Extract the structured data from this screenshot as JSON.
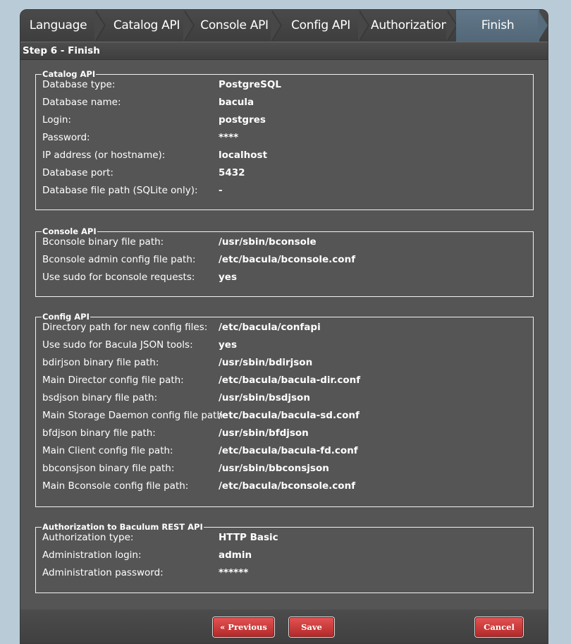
{
  "steps": [
    {
      "label": "Language"
    },
    {
      "label": "Catalog API"
    },
    {
      "label": "Console API"
    },
    {
      "label": "Config API"
    },
    {
      "label": "Authorization"
    },
    {
      "label": "Finish"
    }
  ],
  "active_step": "Finish",
  "step_title": "Step 6 - Finish",
  "sections": {
    "catalog": {
      "legend": "Catalog API",
      "rows": [
        {
          "label": "Database type:",
          "value": "PostgreSQL"
        },
        {
          "label": "Database name:",
          "value": "bacula"
        },
        {
          "label": "Login:",
          "value": "postgres"
        },
        {
          "label": "Password:",
          "value": "****"
        },
        {
          "label": "IP address (or hostname):",
          "value": "localhost"
        },
        {
          "label": "Database port:",
          "value": "5432"
        },
        {
          "label": "Database file path (SQLite only):",
          "value": "-"
        }
      ]
    },
    "console": {
      "legend": "Console API",
      "rows": [
        {
          "label": "Bconsole binary file path:",
          "value": "/usr/sbin/bconsole"
        },
        {
          "label": "Bconsole admin config file path:",
          "value": "/etc/bacula/bconsole.conf"
        },
        {
          "label": "Use sudo for bconsole requests:",
          "value": "yes"
        }
      ]
    },
    "config": {
      "legend": "Config API",
      "rows": [
        {
          "label": "Directory path for new config files:",
          "value": "/etc/bacula/confapi"
        },
        {
          "label": "Use sudo for Bacula JSON tools:",
          "value": "yes"
        },
        {
          "label": "bdirjson binary file path:",
          "value": "/usr/sbin/bdirjson"
        },
        {
          "label": "Main Director config file path:",
          "value": "/etc/bacula/bacula-dir.conf"
        },
        {
          "label": "bsdjson binary file path:",
          "value": "/usr/sbin/bsdjson"
        },
        {
          "label": "Main Storage Daemon config file path:",
          "value": "/etc/bacula/bacula-sd.conf"
        },
        {
          "label": "bfdjson binary file path:",
          "value": "/usr/sbin/bfdjson"
        },
        {
          "label": "Main Client config file path:",
          "value": "/etc/bacula/bacula-fd.conf"
        },
        {
          "label": "bbconsjson binary file path:",
          "value": "/usr/sbin/bbconsjson"
        },
        {
          "label": "Main Bconsole config file path:",
          "value": "/etc/bacula/bconsole.conf"
        }
      ]
    },
    "auth": {
      "legend": "Authorization to Baculum REST API",
      "rows": [
        {
          "label": "Authorization type:",
          "value": "HTTP Basic"
        },
        {
          "label": "Administration login:",
          "value": "admin"
        },
        {
          "label": "Administration password:",
          "value": "******"
        }
      ]
    }
  },
  "buttons": {
    "previous": "« Previous",
    "save": "Save",
    "cancel": "Cancel"
  },
  "colors": {
    "accent_step": "#566b7b",
    "button": "#c93a3a",
    "panel": "#555555",
    "page_bg": "#b9cbd6"
  }
}
